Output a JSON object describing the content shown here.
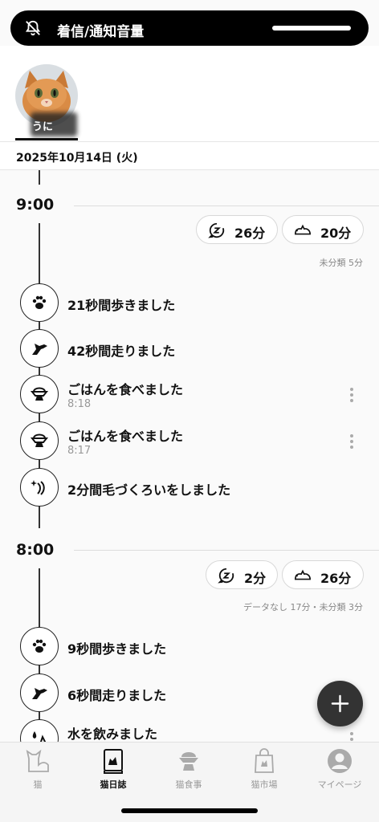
{
  "status_banner": {
    "label": "着信/通知音量"
  },
  "profile": {
    "name": "うに"
  },
  "date": "2025年10月14日 (火)",
  "hours": [
    {
      "label": "9:00",
      "chips": [
        {
          "icon": "sleep-icon",
          "value": "26分"
        },
        {
          "icon": "cat-lying-icon",
          "value": "20分"
        }
      ],
      "summary": "未分類 5分",
      "events": [
        {
          "icon": "paw-icon",
          "title": "21秒間歩きました",
          "time": ""
        },
        {
          "icon": "running-cat-icon",
          "title": "42秒間走りました",
          "time": ""
        },
        {
          "icon": "food-bowl-icon",
          "title": "ごはんを食べました",
          "time": "8:18"
        },
        {
          "icon": "food-bowl-icon",
          "title": "ごはんを食べました",
          "time": "8:17"
        },
        {
          "icon": "grooming-icon",
          "title": "2分間毛づくろいをしました",
          "time": ""
        }
      ]
    },
    {
      "label": "8:00",
      "chips": [
        {
          "icon": "sleep-icon",
          "value": "2分"
        },
        {
          "icon": "cat-lying-icon",
          "value": "26分"
        }
      ],
      "summary": "データなし 17分・未分類 3分",
      "events": [
        {
          "icon": "paw-icon",
          "title": "9秒間歩きました",
          "time": ""
        },
        {
          "icon": "running-cat-icon",
          "title": "6秒間走りました",
          "time": ""
        },
        {
          "icon": "water-icon",
          "title": "水を飲みました",
          "time": ""
        }
      ]
    }
  ],
  "tabs": [
    {
      "icon": "cat-icon",
      "label": "猫",
      "active": false
    },
    {
      "icon": "diary-icon",
      "label": "猫日誌",
      "active": true
    },
    {
      "icon": "cat-food-icon",
      "label": "猫食事",
      "active": false
    },
    {
      "icon": "shopping-bag-icon",
      "label": "猫市場",
      "active": false
    },
    {
      "icon": "user-icon",
      "label": "マイページ",
      "active": false
    }
  ]
}
